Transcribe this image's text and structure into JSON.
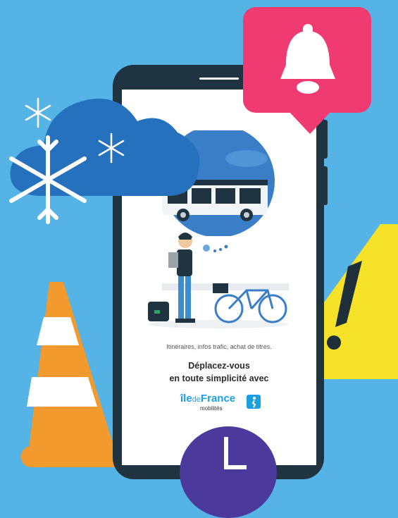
{
  "screen": {
    "tagline": "Itinéraires, infos trafic, achat de titres.",
    "headline_line1": "Déplacez-vous",
    "headline_line2": "en toute simplicité avec",
    "brand": {
      "name_prefix": "île",
      "name_de": "de",
      "name_suffix": "France",
      "subtitle": "mobilités"
    }
  },
  "colors": {
    "background": "#55b3e6",
    "phone": "#1f3440",
    "bell": "#ef3a72",
    "cloud": "#2571bd",
    "cone": "#f39a2e",
    "warning": "#f7e22a",
    "clock": "#4b3a9c",
    "brand_blue": "#1ba0e3"
  },
  "icons": [
    "snowflake-icon",
    "cloud-icon",
    "bell-icon",
    "traffic-cone-icon",
    "warning-icon",
    "clock-icon",
    "bus-icon",
    "bicycle-icon"
  ]
}
